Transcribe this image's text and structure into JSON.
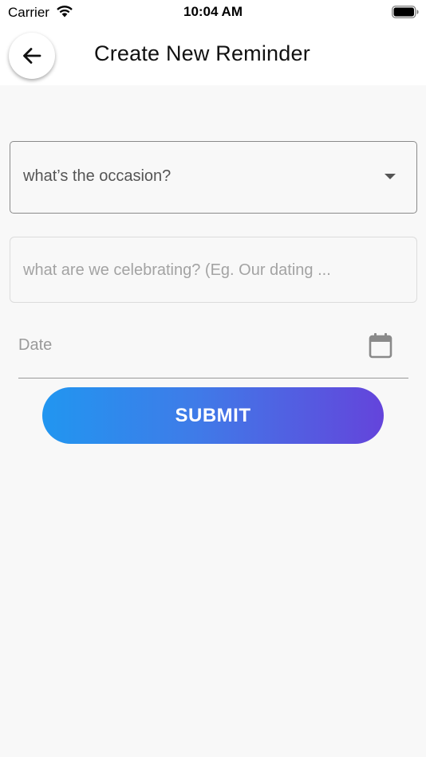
{
  "status_bar": {
    "carrier": "Carrier",
    "time": "10:04 AM",
    "wifi_icon": "wifi-icon",
    "battery_icon": "battery-full-icon"
  },
  "app_bar": {
    "back_icon": "arrow-left-icon",
    "title": "Create New Reminder"
  },
  "form": {
    "occasion_select": {
      "value": "what’s the occasion?",
      "icon": "dropdown-arrow-icon"
    },
    "celebrate_input": {
      "placeholder": "what are we celebrating? (Eg. Our dating ...",
      "value": ""
    },
    "date_field": {
      "label": "Date",
      "icon": "calendar-icon"
    },
    "submit_label": "SUBMIT"
  },
  "colors": {
    "submit_gradient_start": "#2196f0",
    "submit_gradient_end": "#6444db",
    "background": "#f8f8f8"
  }
}
